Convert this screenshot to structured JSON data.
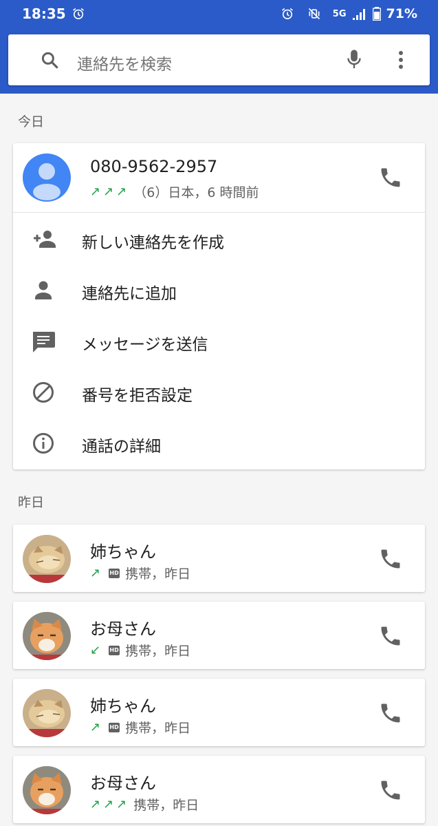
{
  "status_bar": {
    "time": "18:35",
    "network": "5G",
    "battery": "71%"
  },
  "search": {
    "placeholder": "連絡先を検索"
  },
  "sections": {
    "today": "今日",
    "yesterday": "昨日"
  },
  "expanded_call": {
    "number": "080-9562-2957",
    "arrows": "↗↗↗",
    "detail": "（6）日本，6 時間前"
  },
  "actions": [
    {
      "label": "新しい連絡先を作成",
      "icon": "add-person-icon"
    },
    {
      "label": "連絡先に追加",
      "icon": "person-icon"
    },
    {
      "label": "メッセージを送信",
      "icon": "message-icon"
    },
    {
      "label": "番号を拒否設定",
      "icon": "block-icon"
    },
    {
      "label": "通話の詳細",
      "icon": "info-icon"
    }
  ],
  "calls": [
    {
      "name": "姉ちゃん",
      "arrows": "↗",
      "hd": "HD",
      "detail": "携帯，昨日"
    },
    {
      "name": "お母さん",
      "arrows": "↙",
      "hd": "HD",
      "detail": "携帯，昨日"
    },
    {
      "name": "姉ちゃん",
      "arrows": "↗",
      "hd": "HD",
      "detail": "携帯，昨日"
    },
    {
      "name": "お母さん",
      "arrows": "↗↗↗",
      "detail": "携帯，昨日"
    }
  ],
  "colors": {
    "app_bar": "#2b5bc8",
    "outgoing_arrow": "#1fa04a",
    "avatar_default": "#4285f4"
  }
}
